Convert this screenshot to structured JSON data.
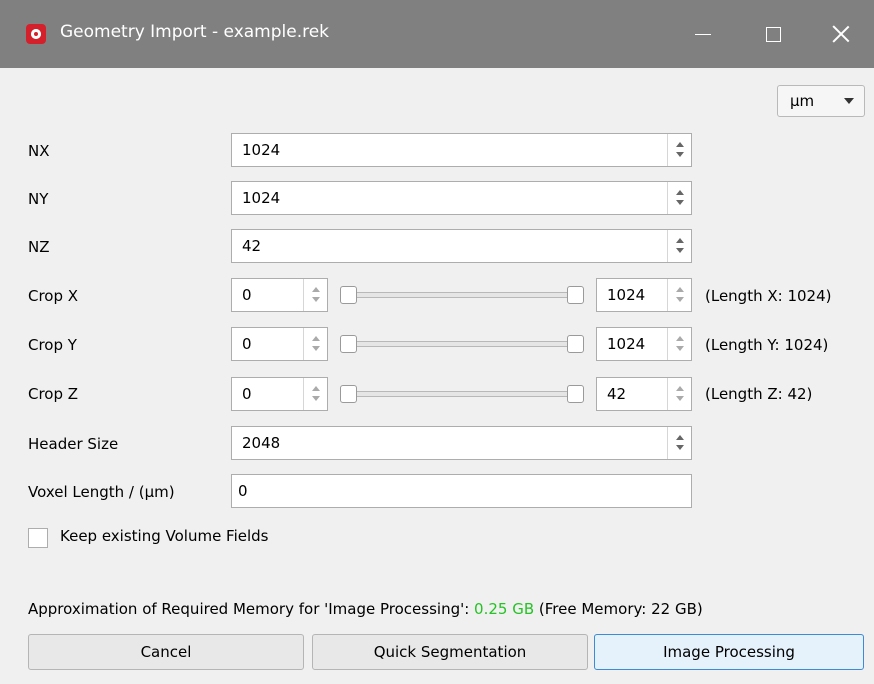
{
  "window": {
    "title": "Geometry Import - example.rek",
    "icon": "app-logo-icon",
    "controls": [
      "minimize-icon",
      "maximize-icon",
      "close-icon"
    ]
  },
  "unit": {
    "selected": "µm"
  },
  "fields": {
    "nx": {
      "label": "NX",
      "value": "1024"
    },
    "ny": {
      "label": "NY",
      "value": "1024"
    },
    "nz": {
      "label": "NZ",
      "value": "42"
    },
    "header": {
      "label": "Header Size",
      "value": "2048"
    },
    "voxel": {
      "label": "Voxel Length / (µm)",
      "value": "0"
    }
  },
  "crop": {
    "x": {
      "label": "Crop X",
      "min": "0",
      "max": "1024",
      "length": "(Length X: 1024)"
    },
    "y": {
      "label": "Crop Y",
      "min": "0",
      "max": "1024",
      "length": "(Length Y: 1024)"
    },
    "z": {
      "label": "Crop Z",
      "min": "0",
      "max": "42",
      "length": "(Length Z: 42)"
    }
  },
  "checkbox": {
    "label": "Keep existing Volume Fields",
    "checked": false
  },
  "memory": {
    "prefix": "Approximation of Required Memory for 'Image Processing': ",
    "value": "0.25 GB",
    "suffix": " (Free Memory: 22 GB)",
    "value_color": "#26c226"
  },
  "buttons": {
    "cancel": "Cancel",
    "quick": "Quick Segmentation",
    "process": "Image Processing"
  }
}
